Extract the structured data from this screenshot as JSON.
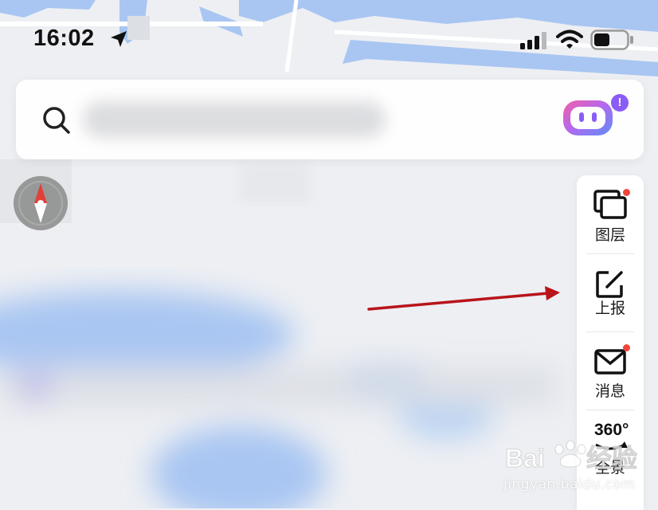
{
  "status_bar": {
    "time": "16:02",
    "icons": [
      "location-arrow-icon",
      "cellular-signal-icon",
      "wifi-icon",
      "battery-icon"
    ]
  },
  "search": {
    "icon": "search-icon",
    "placeholder": "",
    "assistant_icon": "assistant-robot-icon",
    "assistant_badge": "!"
  },
  "compass": {
    "icon": "compass-icon"
  },
  "toolbar": {
    "items": [
      {
        "label": "图层",
        "icon": "layers-icon",
        "has_dot": true
      },
      {
        "label": "上报",
        "icon": "report-edit-icon",
        "has_dot": false
      },
      {
        "label": "消息",
        "icon": "mail-icon",
        "has_dot": true
      },
      {
        "label": "全景",
        "icon": "panorama-360-icon",
        "icon_text": "360°",
        "has_dot": false
      }
    ]
  },
  "watermark": {
    "brand": "Bai du 经验",
    "url": "jingyan.baidu.com"
  },
  "colors": {
    "water": "#a9c6f2",
    "annotation_arrow": "#b8141a",
    "badge_purple": "#8a5cf6",
    "dot_red": "#f0473a"
  }
}
